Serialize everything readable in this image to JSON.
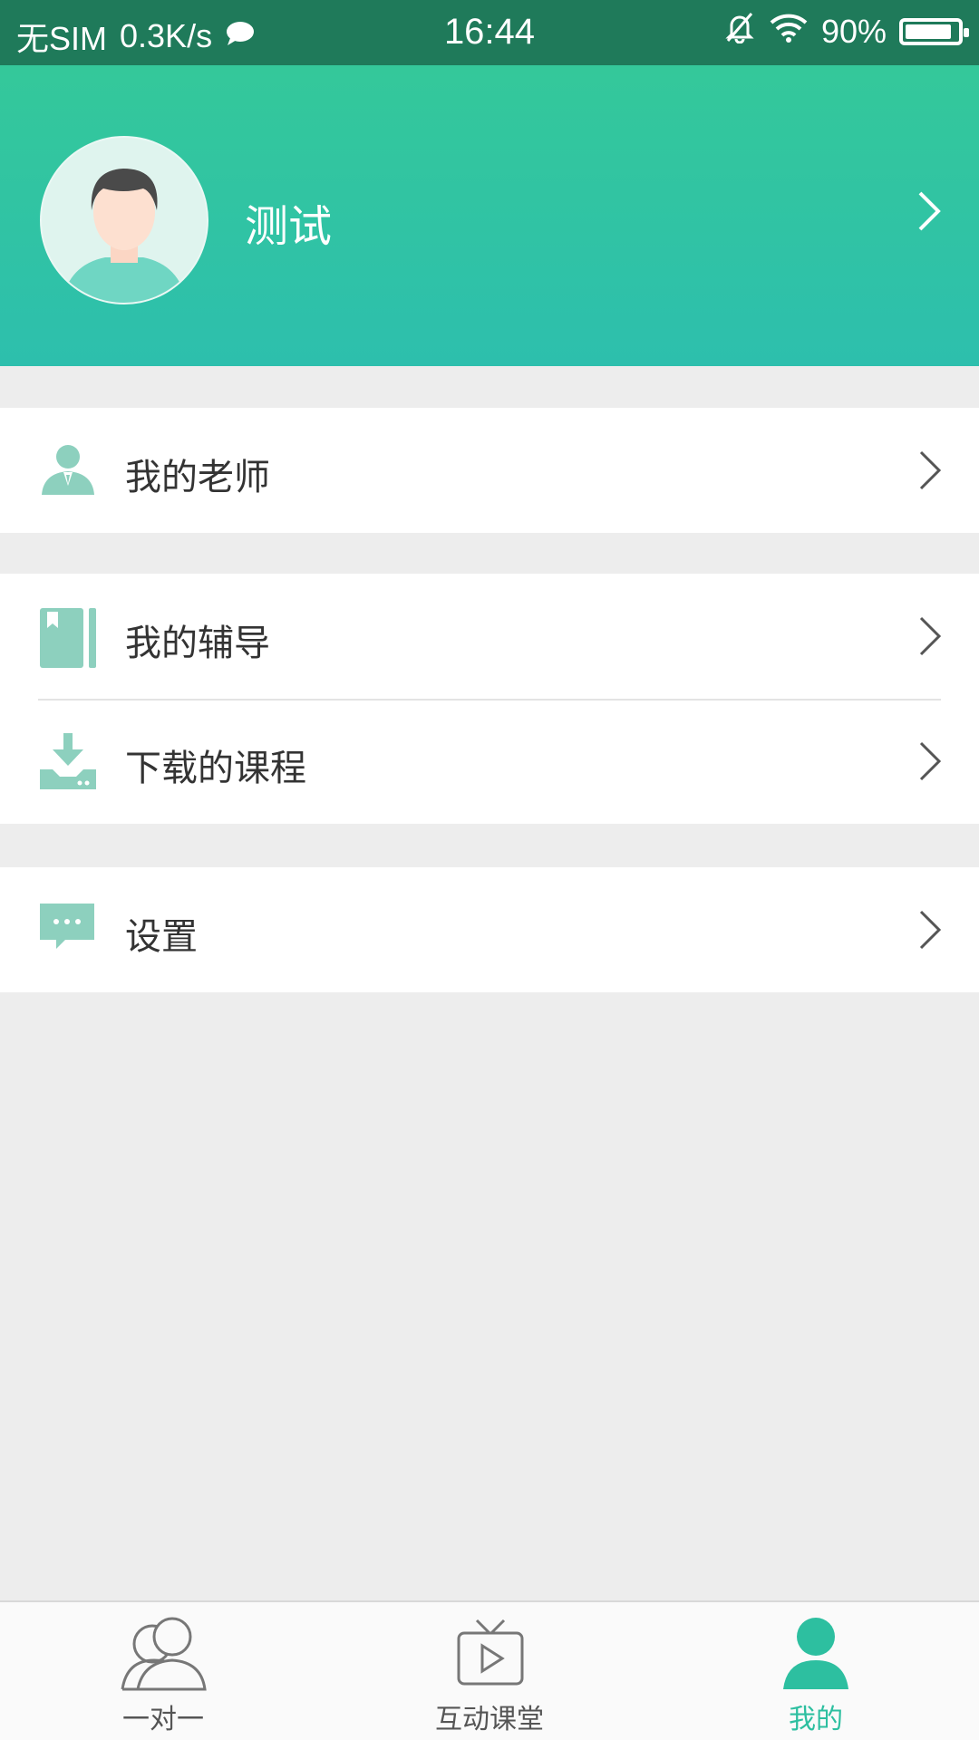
{
  "status_bar": {
    "carrier": "无SIM",
    "speed": "0.3K/s",
    "time": "16:44",
    "battery": "90%",
    "battery_level": 0.9
  },
  "profile": {
    "name": "测试"
  },
  "menu": {
    "groups": [
      {
        "items": [
          {
            "label": "我的老师",
            "icon": "teacher-icon"
          }
        ]
      },
      {
        "items": [
          {
            "label": "我的辅导",
            "icon": "book-icon"
          },
          {
            "label": "下载的课程",
            "icon": "download-icon"
          }
        ]
      },
      {
        "items": [
          {
            "label": "设置",
            "icon": "chat-bubble-icon"
          }
        ]
      }
    ]
  },
  "tabs": [
    {
      "label": "一对一",
      "icon": "two-people-icon",
      "active": false
    },
    {
      "label": "互动课堂",
      "icon": "tv-play-icon",
      "active": false
    },
    {
      "label": "我的",
      "icon": "person-icon",
      "active": true
    }
  ],
  "colors": {
    "brand": "#2dbfa0",
    "status_bar": "#1f7a5a",
    "icon": "#8dd0be",
    "background": "#ededed"
  }
}
